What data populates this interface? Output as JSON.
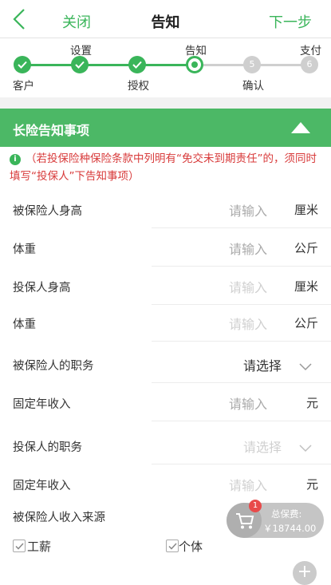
{
  "header": {
    "title": "告知",
    "close_label": "关闭",
    "next_label": "下一步"
  },
  "stepper": {
    "steps": [
      {
        "label": "客户",
        "position": "bottom",
        "state": "done"
      },
      {
        "label": "设置",
        "position": "top",
        "state": "done"
      },
      {
        "label": "授权",
        "position": "bottom",
        "state": "done"
      },
      {
        "label": "告知",
        "position": "top",
        "state": "current"
      },
      {
        "label": "确认",
        "position": "bottom",
        "state": "todo",
        "number": "5"
      },
      {
        "label": "支付",
        "position": "top",
        "state": "todo",
        "number": "6"
      }
    ]
  },
  "section": {
    "title": "长险告知事项"
  },
  "notice": {
    "text": "（若投保险种保险条款中列明有“免交未到期责任”的，须同时填写“投保人”下告知事项）"
  },
  "form": {
    "rows": [
      {
        "label": "被保险人身高",
        "value": "请输入",
        "unit": "厘米",
        "type": "input"
      },
      {
        "label": "体重",
        "value": "请输入",
        "unit": "公斤",
        "type": "input"
      },
      {
        "label": "投保人身高",
        "value": "请输入",
        "unit": "厘米",
        "type": "input-disabled"
      },
      {
        "label": "体重",
        "value": "请输入",
        "unit": "公斤",
        "type": "input-disabled"
      },
      {
        "label": "被保险人的职务",
        "value": "请选择",
        "type": "select"
      },
      {
        "label": "固定年收入",
        "value": "请输入",
        "unit": "元",
        "type": "input"
      },
      {
        "label": "投保人的职务",
        "value": "请选择",
        "type": "select-disabled"
      },
      {
        "label": "固定年收入",
        "value": "请输入",
        "unit": "元",
        "type": "input-disabled"
      }
    ],
    "income_source": {
      "label": "被保险人收入来源",
      "options": [
        {
          "label": "工薪",
          "checked": true
        },
        {
          "label": "个体",
          "checked": true
        }
      ]
    }
  },
  "cart": {
    "badge": "1",
    "title": "总保费:",
    "amount": "￥18744.00"
  },
  "fab": {
    "symbol": "+"
  },
  "colors": {
    "accent": "#3ab55a",
    "section_bg": "#4cb866",
    "notice_text": "#d83a3a"
  }
}
